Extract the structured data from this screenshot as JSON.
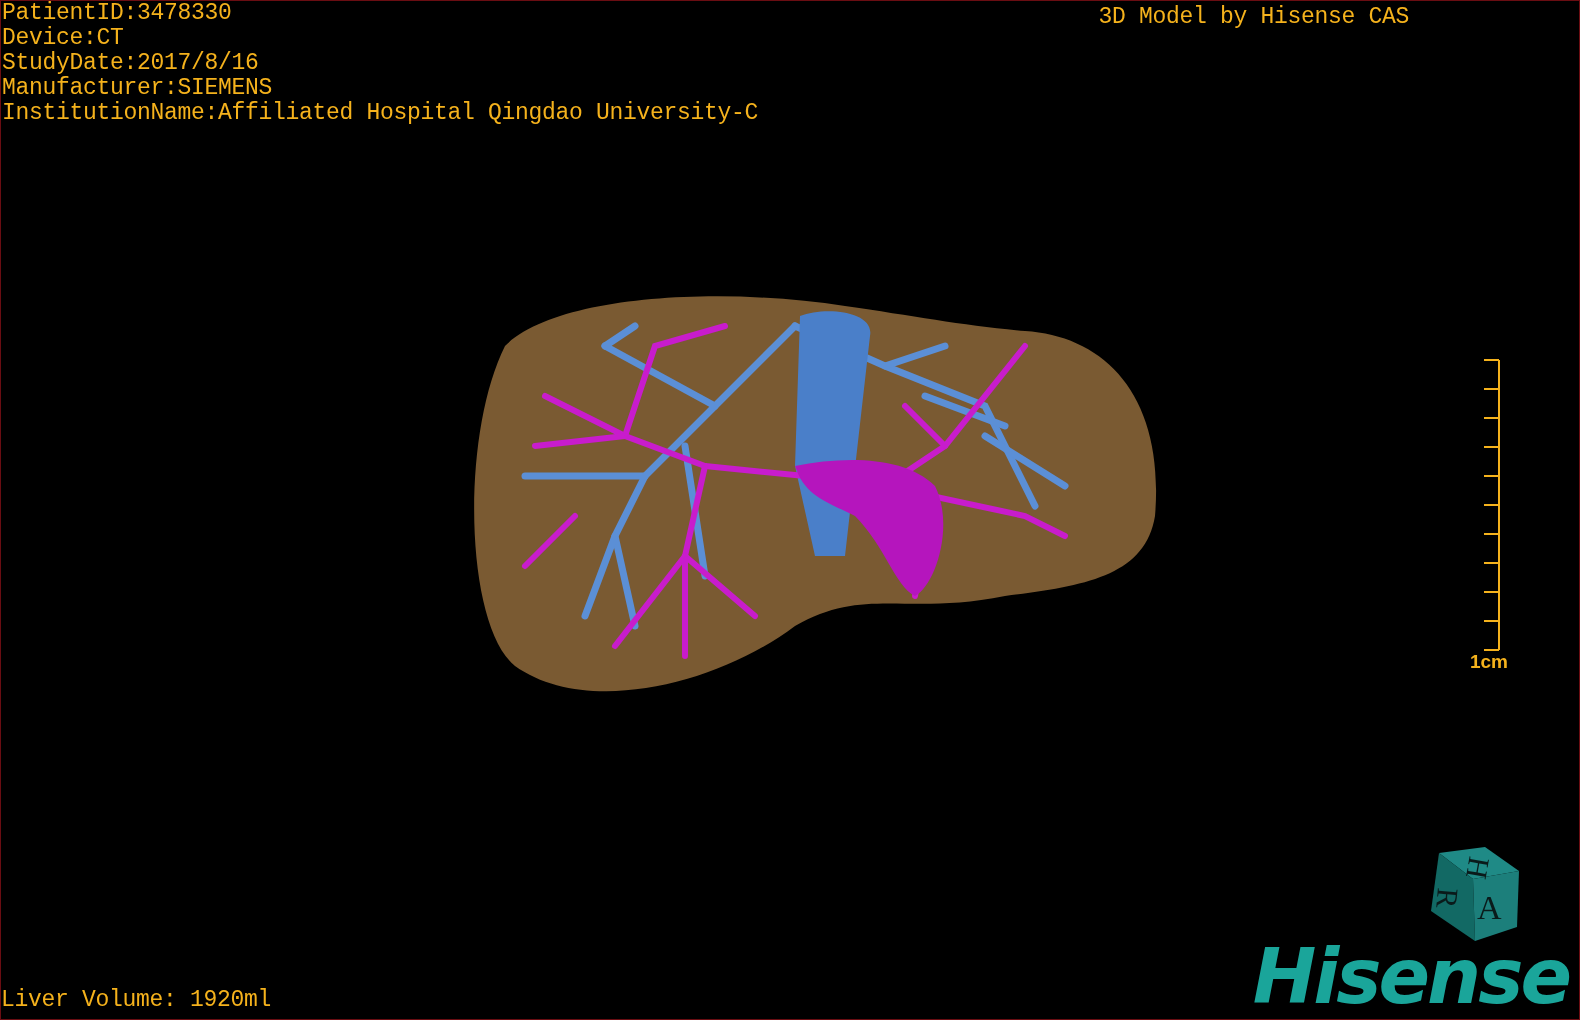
{
  "patient_info": [
    "PatientID:3478330",
    "Device:CT",
    "StudyDate:2017/8/16",
    "Manufacturer:SIEMENS",
    "InstitutionName:Affiliated Hospital Qingdao University-C"
  ],
  "title": "3D Model by Hisense CAS",
  "scale_bar": {
    "label": "1cm"
  },
  "liver_volume": "Liver Volume: 1920ml",
  "orientation_cube": {
    "top": "H",
    "side": "R",
    "front": "A"
  },
  "logo": "Hisense"
}
